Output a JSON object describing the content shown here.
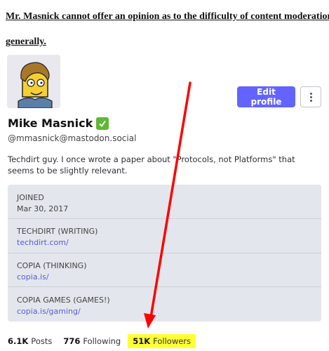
{
  "headline": {
    "line1": "Mr. Masnick cannot offer an opinion as to the difficulty of content moderation",
    "line2": "generally."
  },
  "profile": {
    "avatar_icon": "cartoon-avatar-icon",
    "edit_label": "Edit profile",
    "more_icon": "more-vertical-icon",
    "display_name": "Mike Masnick",
    "verified_icon": "check-mark-icon",
    "handle": "@mmasnick@mastodon.social",
    "bio": "Techdirt guy. I once wrote a paper about \"Protocols, not Platforms\" that seems to be slightly relevant."
  },
  "fields": [
    {
      "label": "JOINED",
      "value": "Mar 30, 2017"
    },
    {
      "label": "TECHDIRT (WRITING)",
      "value": "techdirt.com/"
    },
    {
      "label": "COPIA (THINKING)",
      "value": "copia.is/"
    },
    {
      "label": "COPIA GAMES (GAMES!)",
      "value": "copia.is/gaming/"
    }
  ],
  "stats": {
    "posts_count": "6.1K",
    "posts_label": "Posts",
    "following_count": "776",
    "following_label": "Following",
    "followers_count": "51K",
    "followers_label": "Followers"
  },
  "colors": {
    "accent": "#6364ff",
    "highlight": "#ffff33",
    "arrow": "#ff0000",
    "verified": "#5fb832"
  }
}
